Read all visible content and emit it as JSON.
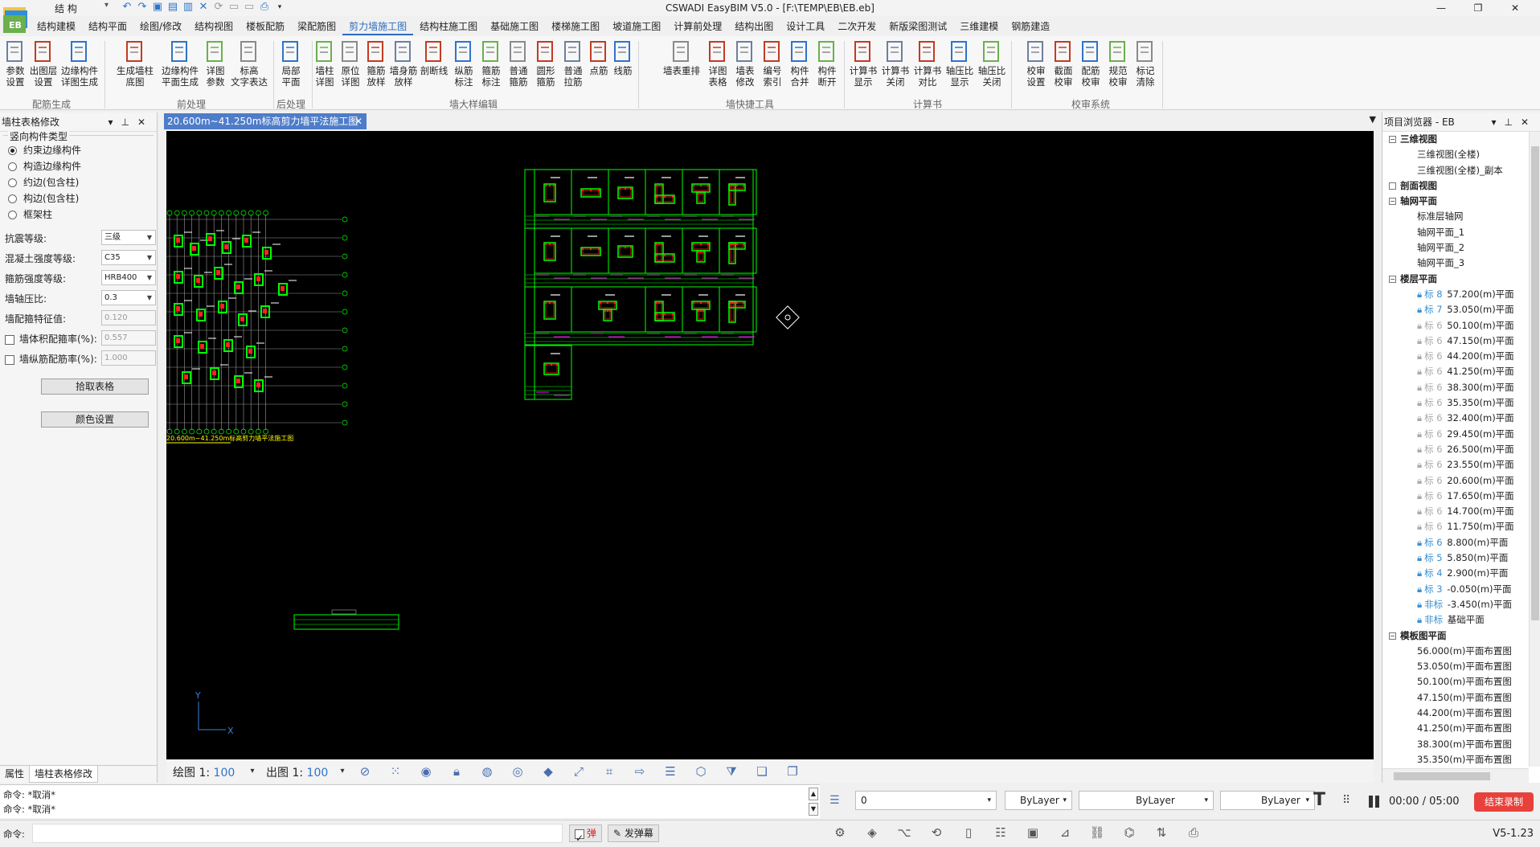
{
  "titlebar": {
    "module": "结  构",
    "title": "CSWADI EasyBIM V5.0 - [F:\\TEMP\\EB\\EB.eb]",
    "logo_text": "EB"
  },
  "menu_tabs": [
    "结构建模",
    "结构平面",
    "绘图/修改",
    "结构视图",
    "楼板配筋",
    "梁配筋图",
    "剪力墙施工图",
    "结构柱施工图",
    "基础施工图",
    "楼梯施工图",
    "坡道施工图",
    "计算前处理",
    "结构出图",
    "设计工具",
    "二次开发",
    "新版梁图测试",
    "三维建模",
    "钢筋建造"
  ],
  "active_tab": "剪力墙施工图",
  "ribbon": {
    "groups": [
      {
        "label": "配筋生成",
        "buttons": [
          "参数\n设置",
          "出图层\n设置",
          "边缘构件\n详图生成"
        ]
      },
      {
        "label": "前处理",
        "buttons": [
          "生成墙柱\n底图",
          "边缘构件\n平面生成",
          "详图\n参数",
          "标高\n文字表达"
        ]
      },
      {
        "label": "后处理",
        "buttons": [
          "局部\n平面"
        ]
      },
      {
        "label": "墙大样编辑",
        "buttons": [
          "墙柱\n详图",
          "原位\n详图",
          "箍筋\n放样",
          "墙身筋\n放样",
          "剖断线",
          "纵筋\n标注",
          "箍筋\n标注",
          "普通\n箍筋",
          "圆形\n箍筋",
          "普通\n拉筋",
          "点筋",
          "线筋"
        ]
      },
      {
        "label": "墙快捷工具",
        "buttons": [
          "墙表重排",
          "详图\n表格",
          "墙表\n修改",
          "编号\n索引",
          "构件\n合并",
          "构件\n断开"
        ]
      },
      {
        "label": "计算书",
        "buttons": [
          "计算书\n显示",
          "计算书\n关闭",
          "计算书\n对比",
          "轴压比\n显示",
          "轴压比\n关闭"
        ]
      },
      {
        "label": "校审系统",
        "buttons": [
          "校审\n设置",
          "截面\n校审",
          "配筋\n校审",
          "规范\n校审",
          "标记\n清除"
        ]
      }
    ]
  },
  "left_panel": {
    "title": "墙柱表格修改",
    "type_legend": "竖向构件类型",
    "types": [
      "约束边缘构件",
      "构造边缘构件",
      "约边(包含柱)",
      "构边(包含柱)",
      "框架柱"
    ],
    "selected_type": 0,
    "fields": [
      {
        "label": "抗震等级:",
        "value": "三级",
        "disabled": false,
        "dropdown": true,
        "checkbox": false
      },
      {
        "label": "混凝土强度等级:",
        "value": "C35",
        "disabled": false,
        "dropdown": true,
        "checkbox": false
      },
      {
        "label": "箍筋强度等级:",
        "value": "HRB400",
        "disabled": false,
        "dropdown": true,
        "checkbox": false
      },
      {
        "label": "墙轴压比:",
        "value": "0.3",
        "disabled": false,
        "dropdown": true,
        "checkbox": false
      },
      {
        "label": "墙配箍特征值:",
        "value": "0.120",
        "disabled": true,
        "dropdown": false,
        "checkbox": false
      },
      {
        "label": "墙体积配箍率(%):",
        "value": "0.557",
        "disabled": true,
        "dropdown": false,
        "checkbox": true
      },
      {
        "label": "墙纵筋配筋率(%):",
        "value": "1.000",
        "disabled": true,
        "dropdown": false,
        "checkbox": true
      }
    ],
    "buttons": [
      "拾取表格",
      "颜色设置"
    ],
    "bottom_tabs": [
      "属性",
      "墙柱表格修改"
    ],
    "active_bottom_tab": "墙柱表格修改"
  },
  "document_tab": "20.600m~41.250m标高剪力墙平法施工图",
  "canvas": {
    "plan_caption": "20.600m~41.250m标高剪力墙平法施工图",
    "axis_x": "X",
    "axis_y": "Y"
  },
  "canvas_strip": {
    "draw_scale_label": "绘图 1:",
    "draw_scale": "100",
    "out_scale_label": "出图 1:",
    "out_scale": "100"
  },
  "right_panel": {
    "title": "项目浏览器 - EB",
    "tree": [
      {
        "level": 0,
        "label": "三维视图",
        "expander": "−"
      },
      {
        "level": 1,
        "label": "三维视图(全楼)"
      },
      {
        "level": 1,
        "label": "三维视图(全楼)_副本"
      },
      {
        "level": 0,
        "label": "剖面视图",
        "expander": ""
      },
      {
        "level": 0,
        "label": "轴网平面",
        "expander": "−"
      },
      {
        "level": 1,
        "label": "标准层轴网"
      },
      {
        "level": 1,
        "label": "轴网平面_1"
      },
      {
        "level": 1,
        "label": "轴网平面_2"
      },
      {
        "level": 1,
        "label": "轴网平面_3"
      },
      {
        "level": 0,
        "label": "楼层平面",
        "expander": "−"
      },
      {
        "level": 1,
        "tag": "标 8",
        "label": "57.200(m)平面",
        "blue": true
      },
      {
        "level": 1,
        "tag": "标 7",
        "label": "53.050(m)平面",
        "blue": true
      },
      {
        "level": 1,
        "tag": "标 6",
        "label": "50.100(m)平面",
        "blue": false
      },
      {
        "level": 1,
        "tag": "标 6",
        "label": "47.150(m)平面",
        "blue": false
      },
      {
        "level": 1,
        "tag": "标 6",
        "label": "44.200(m)平面",
        "blue": false
      },
      {
        "level": 1,
        "tag": "标 6",
        "label": "41.250(m)平面",
        "blue": false
      },
      {
        "level": 1,
        "tag": "标 6",
        "label": "38.300(m)平面",
        "blue": false
      },
      {
        "level": 1,
        "tag": "标 6",
        "label": "35.350(m)平面",
        "blue": false
      },
      {
        "level": 1,
        "tag": "标 6",
        "label": "32.400(m)平面",
        "blue": false
      },
      {
        "level": 1,
        "tag": "标 6",
        "label": "29.450(m)平面",
        "blue": false
      },
      {
        "level": 1,
        "tag": "标 6",
        "label": "26.500(m)平面",
        "blue": false
      },
      {
        "level": 1,
        "tag": "标 6",
        "label": "23.550(m)平面",
        "blue": false
      },
      {
        "level": 1,
        "tag": "标 6",
        "label": "20.600(m)平面",
        "blue": false
      },
      {
        "level": 1,
        "tag": "标 6",
        "label": "17.650(m)平面",
        "blue": false
      },
      {
        "level": 1,
        "tag": "标 6",
        "label": "14.700(m)平面",
        "blue": false
      },
      {
        "level": 1,
        "tag": "标 6",
        "label": "11.750(m)平面",
        "blue": false
      },
      {
        "level": 1,
        "tag": "标 6",
        "label": "8.800(m)平面",
        "blue": true
      },
      {
        "level": 1,
        "tag": "标 5",
        "label": "5.850(m)平面",
        "blue": true
      },
      {
        "level": 1,
        "tag": "标 4",
        "label": "2.900(m)平面",
        "blue": true
      },
      {
        "level": 1,
        "tag": "标 3",
        "label": "-0.050(m)平面",
        "blue": true
      },
      {
        "level": 1,
        "tag": "非标",
        "label": "-3.450(m)平面",
        "blue": true
      },
      {
        "level": 1,
        "tag": "非标",
        "label": "基础平面",
        "blue": true
      },
      {
        "level": 0,
        "label": "模板图平面",
        "expander": "−"
      },
      {
        "level": 1,
        "label": "56.000(m)平面布置图"
      },
      {
        "level": 1,
        "label": "53.050(m)平面布置图"
      },
      {
        "level": 1,
        "label": "50.100(m)平面布置图"
      },
      {
        "level": 1,
        "label": "47.150(m)平面布置图"
      },
      {
        "level": 1,
        "label": "44.200(m)平面布置图"
      },
      {
        "level": 1,
        "label": "41.250(m)平面布置图"
      },
      {
        "level": 1,
        "label": "38.300(m)平面布置图"
      },
      {
        "level": 1,
        "label": "35.350(m)平面布置图"
      }
    ]
  },
  "command": {
    "lines": [
      "命令: *取消*",
      "命令: *取消*"
    ],
    "prompt": "命令:"
  },
  "props": {
    "layer": "0",
    "color": "ByLayer",
    "linetype": "ByLayer",
    "lineweight": "ByLayer"
  },
  "recorder": {
    "time": "00:00 / 05:00",
    "stop_label": "结束录制"
  },
  "statusbar": {
    "toggle1": "弹",
    "toggle2": "发弹幕",
    "version": "V5-1.23"
  },
  "colors": {
    "accent": "#2d6cc0",
    "doc_tab": "#4e7cc9",
    "cad_green": "#00ff00",
    "cad_red": "#ff2020",
    "cad_magenta": "#ff00ff",
    "cad_yellow": "#ffff00",
    "record_red": "#e8413c"
  }
}
